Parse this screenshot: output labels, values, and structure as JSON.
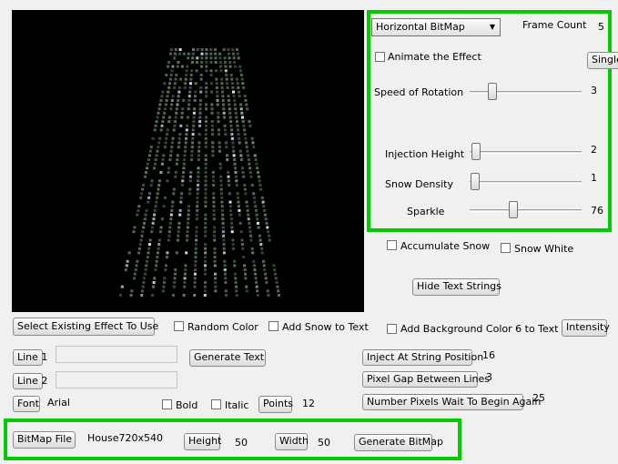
{
  "effect_panel": {
    "dropdown_value": "Horizontal BitMap",
    "frame_count_label": "Frame Count",
    "frame_count_value": "5",
    "animate_label": "Animate the Effect",
    "single_button": "Single",
    "speed_label": "Speed of Rotation",
    "speed_value": "3",
    "injection_label": "Injection Height",
    "injection_value": "2",
    "snow_density_label": "Snow Density",
    "snow_density_value": "1",
    "sparkle_label": "Sparkle",
    "sparkle_value": "76"
  },
  "sliders": {
    "speed_of_rotation": 0.18,
    "injection_height": 0.02,
    "snow_density": 0.01,
    "sparkle": 0.38
  },
  "options": {
    "accumulate_snow": "Accumulate Snow",
    "snow_white": "Snow White",
    "hide_text_strings": "Hide Text Strings",
    "select_existing_effect": "Select Existing Effect To Use",
    "random_color": "Random Color",
    "add_snow_to_text": "Add Snow to Text",
    "add_background_color": "Add Background Color 6 to Text",
    "intensity": "Intensity"
  },
  "text_section": {
    "line1_button": "Line 1",
    "line1_value": "",
    "line2_button": "Line 2",
    "line2_value": "",
    "generate_text": "Generate Text",
    "font_button": "Font",
    "font_name": "Arial",
    "bold": "Bold",
    "italic": "Italic",
    "points_button": "Points",
    "points_value": "12",
    "inject_at_string_position": "Inject At String Position",
    "inject_value": "16",
    "pixel_gap": "Pixel Gap Between Lines",
    "pixel_gap_value": "3",
    "pixels_wait": "Number Pixels Wait To Begin Again",
    "pixels_wait_value": "25"
  },
  "bitmap_panel": {
    "bitmap_file_button": "BitMap File",
    "bitmap_file_name": "House720x540",
    "height_button": "Height",
    "height_value": "50",
    "width_button": "Width",
    "width_value": "50",
    "generate_bitmap": "Generate BitMap"
  },
  "colors": {
    "highlight": "#00cc00",
    "preview_background": "#000000",
    "pixel_dim": "#5a7a5a",
    "pixel_bright": "#cfe8ff"
  }
}
